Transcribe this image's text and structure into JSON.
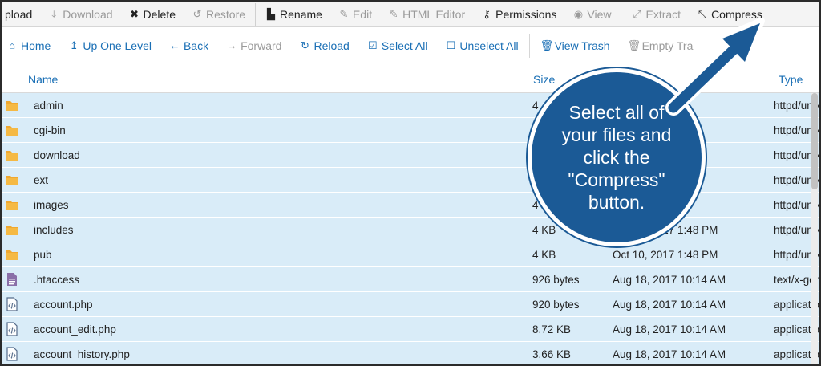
{
  "toolbar": {
    "items": [
      {
        "label": "pload",
        "icon": "upload-icon",
        "glyph": "",
        "disabled": false
      },
      {
        "label": "Download",
        "icon": "download-icon",
        "glyph": "⤓",
        "disabled": true
      },
      {
        "label": "Delete",
        "icon": "close-icon",
        "glyph": "✖",
        "disabled": false
      },
      {
        "label": "Restore",
        "icon": "restore-icon",
        "glyph": "↺",
        "disabled": true
      },
      {
        "label": "Rename",
        "icon": "file-icon",
        "glyph": "▙",
        "disabled": false
      },
      {
        "label": "Edit",
        "icon": "pencil-icon",
        "glyph": "✎",
        "disabled": true
      },
      {
        "label": "HTML Editor",
        "icon": "pencil-icon",
        "glyph": "✎",
        "disabled": true
      },
      {
        "label": "Permissions",
        "icon": "key-icon",
        "glyph": "⚷",
        "disabled": false
      },
      {
        "label": "View",
        "icon": "eye-icon",
        "glyph": "◉",
        "disabled": true
      },
      {
        "label": "Extract",
        "icon": "expand-icon",
        "glyph": "⤢",
        "disabled": true
      },
      {
        "label": "Compress",
        "icon": "compress-icon",
        "glyph": "⤡",
        "disabled": false
      }
    ]
  },
  "nav": {
    "items": [
      {
        "label": "Home",
        "icon": "home-icon",
        "glyph": "⌂",
        "disabled": false
      },
      {
        "label": "Up One Level",
        "icon": "up-arrow-icon",
        "glyph": "↥",
        "disabled": false
      },
      {
        "label": "Back",
        "icon": "back-arrow-icon",
        "glyph": "←",
        "disabled": false
      },
      {
        "label": "Forward",
        "icon": "forward-arrow-icon",
        "glyph": "→",
        "disabled": true
      },
      {
        "label": "Reload",
        "icon": "reload-icon",
        "glyph": "↻",
        "disabled": false
      },
      {
        "label": "Select All",
        "icon": "checkbox-checked-icon",
        "glyph": "☑",
        "disabled": false
      },
      {
        "label": "Unselect All",
        "icon": "checkbox-empty-icon",
        "glyph": "☐",
        "disabled": false
      },
      {
        "label": "View Trash",
        "icon": "trash-icon",
        "glyph": "🗑",
        "disabled": false
      },
      {
        "label": "Empty Tra",
        "icon": "trash-icon",
        "glyph": "🗑",
        "disabled": true
      }
    ]
  },
  "columns": {
    "name": "Name",
    "size": "Size",
    "type": "Type"
  },
  "files": [
    {
      "name": "admin",
      "size": "4",
      "date": "53 PM",
      "type": "httpd/unix",
      "kind": "folder"
    },
    {
      "name": "cgi-bin",
      "size": "4",
      "date": "AM",
      "type": "httpd/unix",
      "kind": "folder"
    },
    {
      "name": "download",
      "size": "4",
      "date": "PM",
      "type": "httpd/unix",
      "kind": "folder"
    },
    {
      "name": "ext",
      "size": "4",
      "date": "48 PM",
      "type": "httpd/unix",
      "kind": "folder"
    },
    {
      "name": "images",
      "size": "4 KB",
      "date": "1:48 PM",
      "type": "httpd/unix",
      "kind": "folder"
    },
    {
      "name": "includes",
      "size": "4 KB",
      "date": "Oct 10, 2017 1:48 PM",
      "type": "httpd/unix",
      "kind": "folder"
    },
    {
      "name": "pub",
      "size": "4 KB",
      "date": "Oct 10, 2017 1:48 PM",
      "type": "httpd/unix",
      "kind": "folder"
    },
    {
      "name": ".htaccess",
      "size": "926 bytes",
      "date": "Aug 18, 2017 10:14 AM",
      "type": "text/x-gen",
      "kind": "text"
    },
    {
      "name": "account.php",
      "size": "920 bytes",
      "date": "Aug 18, 2017 10:14 AM",
      "type": "applicatio",
      "kind": "code"
    },
    {
      "name": "account_edit.php",
      "size": "8.72 KB",
      "date": "Aug 18, 2017 10:14 AM",
      "type": "applicatio",
      "kind": "code"
    },
    {
      "name": "account_history.php",
      "size": "3.66 KB",
      "date": "Aug 18, 2017 10:14 AM",
      "type": "applicatio",
      "kind": "code"
    }
  ],
  "callout": {
    "text": "Select all of your files and click the \"Compress\" button."
  },
  "colors": {
    "selected_row": "#d9ecf8",
    "folder": "#f0a830",
    "link": "#1a6fb5",
    "callout": "#1b5a96"
  }
}
